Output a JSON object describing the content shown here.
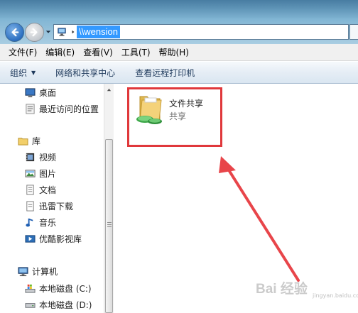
{
  "address": {
    "path": "\\\\wension"
  },
  "menu": [
    "文件(F)",
    "编辑(E)",
    "查看(V)",
    "工具(T)",
    "帮助(H)"
  ],
  "toolbar": {
    "organize": "组织",
    "network_center": "网络和共享中心",
    "remote_printers": "查看远程打印机"
  },
  "nav": {
    "favorites": [
      "桌面",
      "最近访问的位置"
    ],
    "libraries_label": "库",
    "libraries": [
      "视频",
      "图片",
      "文档",
      "迅雷下载",
      "音乐",
      "优酷影视库"
    ],
    "computer_label": "计算机",
    "drives": [
      "本地磁盘 (C:)",
      "本地磁盘 (D:)"
    ]
  },
  "share": {
    "name": "文件共享",
    "type": "共享"
  },
  "watermark": {
    "brand": "Bai 经验",
    "url": "jingyan.baidu.com"
  },
  "colors": {
    "highlight": "#e0383b",
    "selection": "#3399ff"
  },
  "icons": {
    "back": "back-arrow-icon",
    "forward": "forward-arrow-icon",
    "address": "computer-network-icon",
    "share": "shared-folder-icon"
  }
}
